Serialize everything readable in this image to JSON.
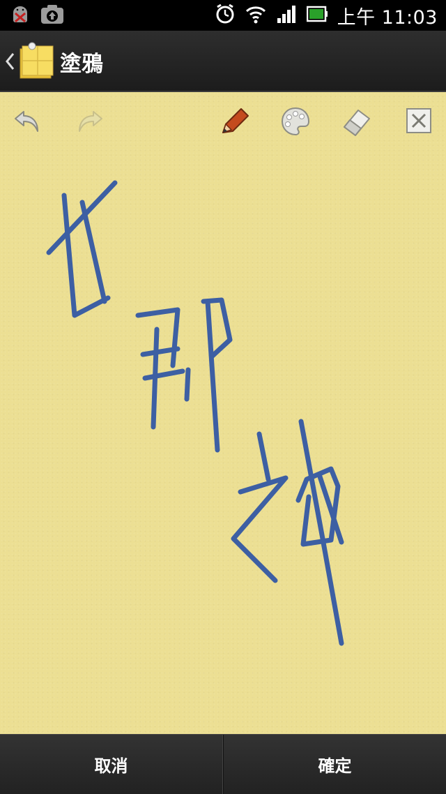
{
  "status_bar": {
    "time": "上午 11:03",
    "icons": [
      "android-debug-icon",
      "camera-upload-icon",
      "alarm-icon",
      "wifi-icon",
      "signal-icon",
      "battery-icon"
    ]
  },
  "action_bar": {
    "title": "塗鴉",
    "icons": [
      "back-chevron-icon",
      "sticky-note-app-icon"
    ]
  },
  "toolbar": {
    "tools": [
      "undo-icon",
      "redo-icon",
      "pencil-icon",
      "palette-icon",
      "eraser-icon",
      "clear-icon"
    ]
  },
  "drawing": {
    "stroke_color": "#3d5fa3",
    "paper_color": "#ecdf93"
  },
  "bottom_bar": {
    "cancel_label": "取消",
    "confirm_label": "確定"
  }
}
